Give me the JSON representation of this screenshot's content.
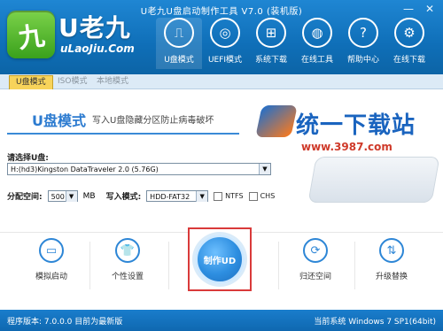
{
  "window": {
    "title": "U老九U盘启动制作工具 V7.0 (装机版)",
    "controls": {
      "minimize": "—",
      "close": "✕"
    }
  },
  "logo": {
    "badge": "九",
    "title": "U老九",
    "subtitle": "uLaoJiu.Com"
  },
  "nav": [
    {
      "label": "U盘模式",
      "icon": "usb-icon"
    },
    {
      "label": "UEFI模式",
      "icon": "disc-icon"
    },
    {
      "label": "系统下载",
      "icon": "windows-icon"
    },
    {
      "label": "在线工具",
      "icon": "globe-icon"
    },
    {
      "label": "帮助中心",
      "icon": "help-icon"
    },
    {
      "label": "在线下载",
      "icon": "network-icon"
    }
  ],
  "tabs": [
    "U盘模式",
    "ISO模式",
    "本地模式"
  ],
  "mode": {
    "title": "U盘模式",
    "desc": "写入U盘隐藏分区防止病毒破坏",
    "select_label": "请选择U盘:",
    "selected_disk": "H:(hd3)Kingston DataTraveler 2.0 (5.76G)",
    "alloc_label": "分配空间:",
    "alloc_value": "500",
    "alloc_unit": "MB",
    "write_mode_label": "写入模式:",
    "write_mode_value": "HDD-FAT32",
    "ntfs_label": "NTFS",
    "chs_label": "CHS"
  },
  "watermark": {
    "text": "统一下载站",
    "url": "www.3987.com"
  },
  "tools": [
    {
      "label": "模拟启动",
      "icon": "monitor-icon"
    },
    {
      "label": "个性设置",
      "icon": "shirt-icon"
    },
    {
      "label": "制作UD",
      "icon": "make-icon"
    },
    {
      "label": "归还空间",
      "icon": "refresh-icon"
    },
    {
      "label": "升级替换",
      "icon": "upgrade-icon"
    }
  ],
  "status": {
    "left": "程序版本: 7.0.0.0  目前为最新版",
    "right": "当前系统 Windows 7 SP1(64bit)"
  }
}
